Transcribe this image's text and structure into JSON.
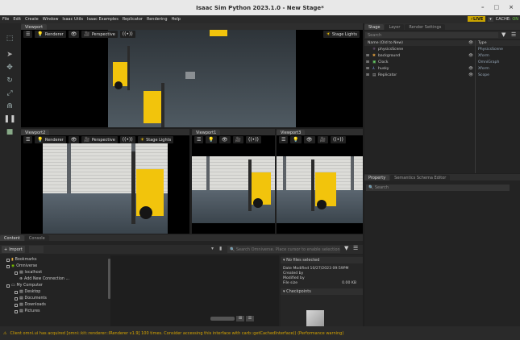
{
  "window": {
    "title": "Isaac Sim Python 2023.1.0 - New Stage*",
    "minimize": "–",
    "maximize": "□",
    "close": "×"
  },
  "menu": [
    "File",
    "Edit",
    "Create",
    "Window",
    "Isaac Utils",
    "Isaac Examples",
    "Replicator",
    "Rendering",
    "Help"
  ],
  "live": {
    "label": "LIVE",
    "cache_label": "CACHE:",
    "cache_status": "ON"
  },
  "viewports": {
    "main": {
      "tab": "Viewport",
      "renderer": "Renderer",
      "camera": "Perspective",
      "lights": "Stage Lights"
    },
    "vp2": {
      "tab": "Viewport2",
      "renderer": "Renderer",
      "camera": "Perspective",
      "lights": "Stage Lights"
    },
    "vp1": {
      "tab": "Viewport1"
    },
    "vp3": {
      "tab": "Viewport3"
    }
  },
  "stage": {
    "tabs": [
      "Stage",
      "Layer",
      "Render Settings"
    ],
    "search_placeholder": "Search",
    "col_name": "Name (Old to New)",
    "col_type": "Type",
    "items": [
      {
        "name": "physicsScene",
        "type": "PhysicsScene"
      },
      {
        "name": "background",
        "type": "Xform"
      },
      {
        "name": "Clock",
        "type": "OmniGraph"
      },
      {
        "name": "husky",
        "type": "Xform"
      },
      {
        "name": "Replicator",
        "type": "Scope"
      }
    ]
  },
  "property": {
    "tabs": [
      "Property",
      "Semantics Schema Editor"
    ],
    "search_placeholder": "Search"
  },
  "content": {
    "tabs": [
      "Content",
      "Console"
    ],
    "import_label": "Import",
    "search_placeholder": "Search Omniverse. Place cursor to enable selection",
    "tree": [
      {
        "label": "Bookmarks",
        "level": 0
      },
      {
        "label": "Omniverse",
        "level": 0
      },
      {
        "label": "localhost",
        "level": 1
      },
      {
        "label": "Add New Connection ...",
        "level": 1
      },
      {
        "label": "My Computer",
        "level": 0
      },
      {
        "label": "Desktop",
        "level": 1
      },
      {
        "label": "Documents",
        "level": 1
      },
      {
        "label": "Downloads",
        "level": 1
      },
      {
        "label": "Pictures",
        "level": 1
      }
    ],
    "details": {
      "header": "No files selected",
      "date_modified_label": "Date Modified",
      "date_modified": "10/27/2023 09:59PM",
      "created_by_label": "Created by",
      "modified_by_label": "Modified by",
      "file_size_label": "File size",
      "file_size": "0.00 KB",
      "checkpoints": "Checkpoints"
    }
  },
  "status": {
    "message": "Client omni.ui has acquired [omni::kit::renderer::IRenderer v1.9] 100 times. Consider accessing this interface with carb::getCachedInterface() (Performance warning)"
  }
}
